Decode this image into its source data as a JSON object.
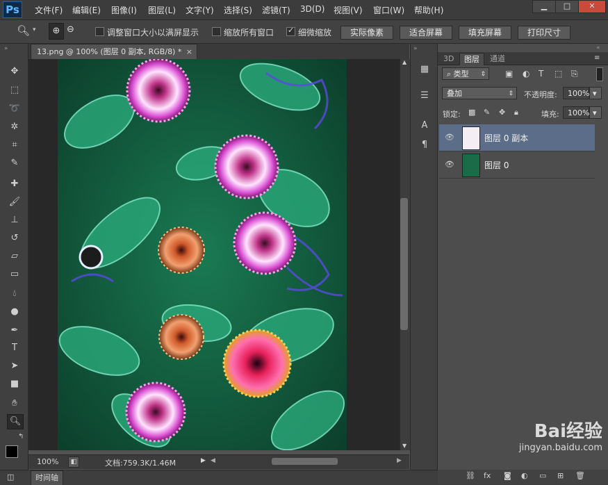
{
  "app": {
    "logo": "Ps"
  },
  "menu": [
    "文件(F)",
    "编辑(E)",
    "图像(I)",
    "图层(L)",
    "文字(Y)",
    "选择(S)",
    "滤镜(T)",
    "3D(D)",
    "视图(V)",
    "窗口(W)",
    "帮助(H)"
  ],
  "window_controls": {
    "minimize": "▁",
    "maximize": "□",
    "close": "✕"
  },
  "options": {
    "tool_icon": "zoom-icon",
    "chk1_label": "调整窗口大小以满屏显示",
    "chk1_checked": false,
    "chk2_label": "缩放所有窗口",
    "chk2_checked": false,
    "chk3_label": "细微缩放",
    "chk3_checked": true,
    "btn_actual": "实际像素",
    "btn_fit": "适合屏幕",
    "btn_fill": "填充屏幕",
    "btn_print": "打印尺寸"
  },
  "document": {
    "tab_title": "13.png @ 100% (图层 0 副本, RGB/8) *",
    "tab_close": "×"
  },
  "status": {
    "zoom": "100%",
    "doc_info": "文档:759.3K/1.46M"
  },
  "timeline": {
    "label": "时间轴"
  },
  "layers_panel": {
    "tabs": [
      "3D",
      "图层",
      "通道"
    ],
    "active_tab": "图层",
    "filter_kind": "类型",
    "blend_mode": "叠加",
    "opacity_label": "不透明度:",
    "opacity_value": "100%",
    "lock_label": "锁定:",
    "fill_label": "填充:",
    "fill_value": "100%",
    "layers": [
      {
        "name": "图层 0 副本",
        "selected": true
      },
      {
        "name": "图层 0",
        "selected": false
      }
    ]
  },
  "watermark": {
    "brand": "Bai经验",
    "url": "jingyan.baidu.com"
  }
}
